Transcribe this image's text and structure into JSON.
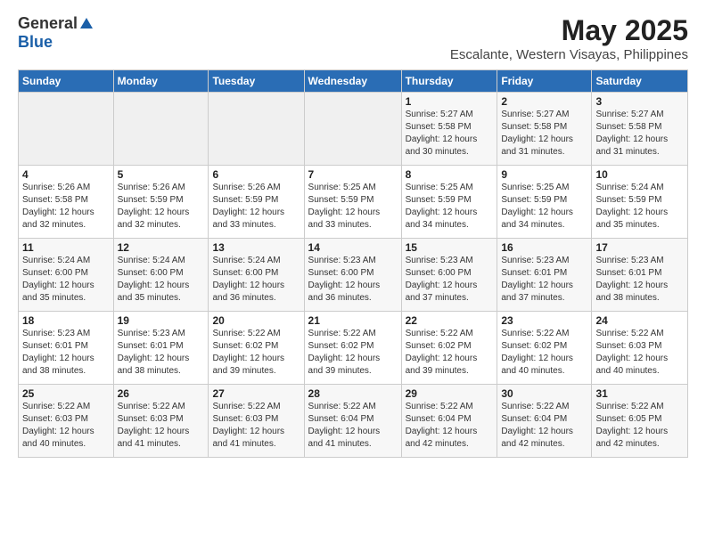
{
  "logo": {
    "general": "General",
    "blue": "Blue"
  },
  "title": "May 2025",
  "subtitle": "Escalante, Western Visayas, Philippines",
  "days_of_week": [
    "Sunday",
    "Monday",
    "Tuesday",
    "Wednesday",
    "Thursday",
    "Friday",
    "Saturday"
  ],
  "weeks": [
    [
      {
        "day": "",
        "info": ""
      },
      {
        "day": "",
        "info": ""
      },
      {
        "day": "",
        "info": ""
      },
      {
        "day": "",
        "info": ""
      },
      {
        "day": "1",
        "info": "Sunrise: 5:27 AM\nSunset: 5:58 PM\nDaylight: 12 hours\nand 30 minutes."
      },
      {
        "day": "2",
        "info": "Sunrise: 5:27 AM\nSunset: 5:58 PM\nDaylight: 12 hours\nand 31 minutes."
      },
      {
        "day": "3",
        "info": "Sunrise: 5:27 AM\nSunset: 5:58 PM\nDaylight: 12 hours\nand 31 minutes."
      }
    ],
    [
      {
        "day": "4",
        "info": "Sunrise: 5:26 AM\nSunset: 5:58 PM\nDaylight: 12 hours\nand 32 minutes."
      },
      {
        "day": "5",
        "info": "Sunrise: 5:26 AM\nSunset: 5:59 PM\nDaylight: 12 hours\nand 32 minutes."
      },
      {
        "day": "6",
        "info": "Sunrise: 5:26 AM\nSunset: 5:59 PM\nDaylight: 12 hours\nand 33 minutes."
      },
      {
        "day": "7",
        "info": "Sunrise: 5:25 AM\nSunset: 5:59 PM\nDaylight: 12 hours\nand 33 minutes."
      },
      {
        "day": "8",
        "info": "Sunrise: 5:25 AM\nSunset: 5:59 PM\nDaylight: 12 hours\nand 34 minutes."
      },
      {
        "day": "9",
        "info": "Sunrise: 5:25 AM\nSunset: 5:59 PM\nDaylight: 12 hours\nand 34 minutes."
      },
      {
        "day": "10",
        "info": "Sunrise: 5:24 AM\nSunset: 5:59 PM\nDaylight: 12 hours\nand 35 minutes."
      }
    ],
    [
      {
        "day": "11",
        "info": "Sunrise: 5:24 AM\nSunset: 6:00 PM\nDaylight: 12 hours\nand 35 minutes."
      },
      {
        "day": "12",
        "info": "Sunrise: 5:24 AM\nSunset: 6:00 PM\nDaylight: 12 hours\nand 35 minutes."
      },
      {
        "day": "13",
        "info": "Sunrise: 5:24 AM\nSunset: 6:00 PM\nDaylight: 12 hours\nand 36 minutes."
      },
      {
        "day": "14",
        "info": "Sunrise: 5:23 AM\nSunset: 6:00 PM\nDaylight: 12 hours\nand 36 minutes."
      },
      {
        "day": "15",
        "info": "Sunrise: 5:23 AM\nSunset: 6:00 PM\nDaylight: 12 hours\nand 37 minutes."
      },
      {
        "day": "16",
        "info": "Sunrise: 5:23 AM\nSunset: 6:01 PM\nDaylight: 12 hours\nand 37 minutes."
      },
      {
        "day": "17",
        "info": "Sunrise: 5:23 AM\nSunset: 6:01 PM\nDaylight: 12 hours\nand 38 minutes."
      }
    ],
    [
      {
        "day": "18",
        "info": "Sunrise: 5:23 AM\nSunset: 6:01 PM\nDaylight: 12 hours\nand 38 minutes."
      },
      {
        "day": "19",
        "info": "Sunrise: 5:23 AM\nSunset: 6:01 PM\nDaylight: 12 hours\nand 38 minutes."
      },
      {
        "day": "20",
        "info": "Sunrise: 5:22 AM\nSunset: 6:02 PM\nDaylight: 12 hours\nand 39 minutes."
      },
      {
        "day": "21",
        "info": "Sunrise: 5:22 AM\nSunset: 6:02 PM\nDaylight: 12 hours\nand 39 minutes."
      },
      {
        "day": "22",
        "info": "Sunrise: 5:22 AM\nSunset: 6:02 PM\nDaylight: 12 hours\nand 39 minutes."
      },
      {
        "day": "23",
        "info": "Sunrise: 5:22 AM\nSunset: 6:02 PM\nDaylight: 12 hours\nand 40 minutes."
      },
      {
        "day": "24",
        "info": "Sunrise: 5:22 AM\nSunset: 6:03 PM\nDaylight: 12 hours\nand 40 minutes."
      }
    ],
    [
      {
        "day": "25",
        "info": "Sunrise: 5:22 AM\nSunset: 6:03 PM\nDaylight: 12 hours\nand 40 minutes."
      },
      {
        "day": "26",
        "info": "Sunrise: 5:22 AM\nSunset: 6:03 PM\nDaylight: 12 hours\nand 41 minutes."
      },
      {
        "day": "27",
        "info": "Sunrise: 5:22 AM\nSunset: 6:03 PM\nDaylight: 12 hours\nand 41 minutes."
      },
      {
        "day": "28",
        "info": "Sunrise: 5:22 AM\nSunset: 6:04 PM\nDaylight: 12 hours\nand 41 minutes."
      },
      {
        "day": "29",
        "info": "Sunrise: 5:22 AM\nSunset: 6:04 PM\nDaylight: 12 hours\nand 42 minutes."
      },
      {
        "day": "30",
        "info": "Sunrise: 5:22 AM\nSunset: 6:04 PM\nDaylight: 12 hours\nand 42 minutes."
      },
      {
        "day": "31",
        "info": "Sunrise: 5:22 AM\nSunset: 6:05 PM\nDaylight: 12 hours\nand 42 minutes."
      }
    ]
  ]
}
